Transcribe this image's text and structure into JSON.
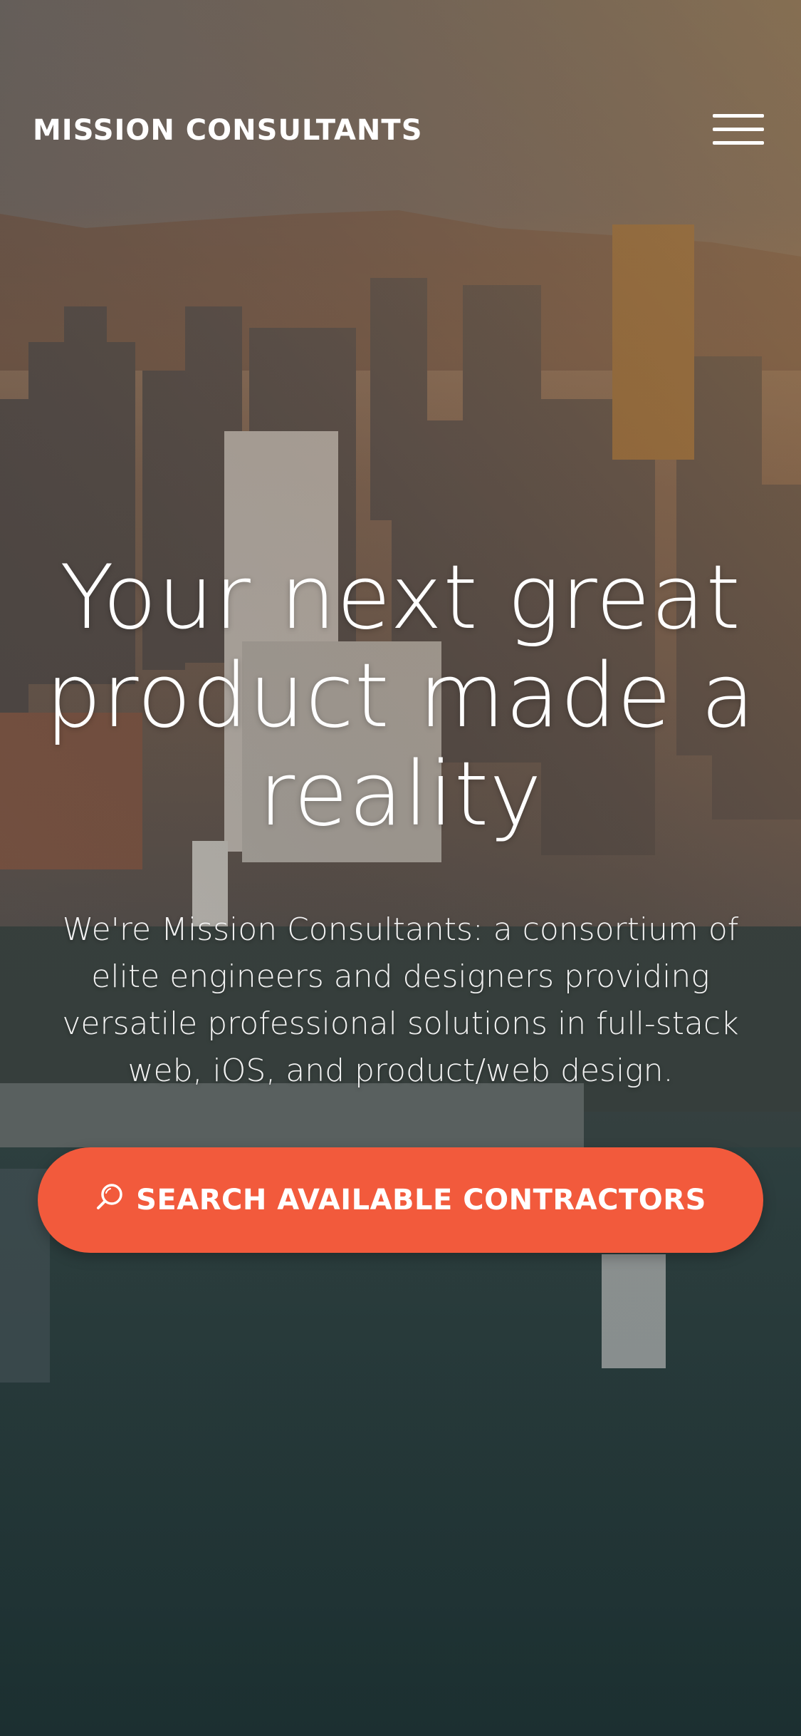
{
  "header": {
    "brand": "MISSION CONSULTANTS",
    "menu_icon": "hamburger-menu-icon"
  },
  "hero": {
    "headline": "Your next great product made a reality",
    "subtitle": "We're Mission Consultants: a consortium of elite engineers and designers providing versatile professional solutions in full-stack web, iOS, and product/web design."
  },
  "cta": {
    "label": "SEARCH AVAILABLE CONTRACTORS",
    "icon": "search-icon",
    "color": "#f25a3c"
  },
  "background": {
    "description_icon": "city-skyline-photo"
  }
}
